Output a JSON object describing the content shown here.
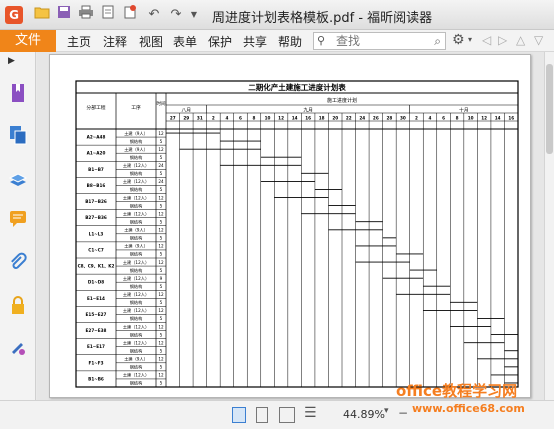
{
  "window": {
    "title": "周进度计划表格模板.pdf - 福昕阅读器",
    "logo_letter": "G"
  },
  "menu": {
    "file": "文件",
    "items": [
      "主页",
      "注释",
      "视图",
      "表单",
      "保护",
      "共享",
      "帮助"
    ]
  },
  "search": {
    "placeholder": "查找"
  },
  "document": {
    "title": "二期化产土建施工进度计划表",
    "header_group": "施工进度计划",
    "col_section": "分部工程",
    "col_process": "工序",
    "col_time": "时间",
    "months": [
      "八月",
      "九月",
      "十月"
    ],
    "days": [
      "27",
      "29",
      "31",
      "2",
      "4",
      "6",
      "8",
      "10",
      "12",
      "14",
      "16",
      "18",
      "20",
      "22",
      "24",
      "26",
      "28",
      "30",
      "2",
      "4",
      "6",
      "8",
      "10",
      "12",
      "14",
      "16"
    ],
    "sections": [
      "A2~A48",
      "A1~A20",
      "B1~B7",
      "B8~B16",
      "B17~B26",
      "B27~B36",
      "L1~L3",
      "C1~C7",
      "C8、C9、K1、K2",
      "D1~D8",
      "E1~E14",
      "E15~E27",
      "E27~E38",
      "E1~E17",
      "F1~F3",
      "B1~B6"
    ],
    "rows": [
      {
        "p": "土建（9人）",
        "t": "12"
      },
      {
        "p": "钢结构",
        "t": "5"
      },
      {
        "p": "土建（9人）",
        "t": "12"
      },
      {
        "p": "钢结构",
        "t": "5"
      },
      {
        "p": "土建（12人）",
        "t": "24"
      },
      {
        "p": "钢结构",
        "t": "5"
      },
      {
        "p": "土建（12人）",
        "t": "24"
      },
      {
        "p": "钢结构",
        "t": "5"
      },
      {
        "p": "土建（12人）",
        "t": "12"
      },
      {
        "p": "钢结构",
        "t": "5"
      },
      {
        "p": "土建（12人）",
        "t": "12"
      },
      {
        "p": "钢结构",
        "t": "5"
      },
      {
        "p": "土建（9人）",
        "t": "12"
      },
      {
        "p": "钢结构",
        "t": "5"
      },
      {
        "p": "土建（9人）",
        "t": "12"
      },
      {
        "p": "钢结构",
        "t": "5"
      },
      {
        "p": "土建（12人）",
        "t": "12"
      },
      {
        "p": "钢结构",
        "t": "5"
      },
      {
        "p": "土建（12人）",
        "t": "9"
      },
      {
        "p": "钢结构",
        "t": "5"
      },
      {
        "p": "土建（12人）",
        "t": "12"
      },
      {
        "p": "钢结构",
        "t": "5"
      },
      {
        "p": "土建（12人）",
        "t": "12"
      },
      {
        "p": "钢结构",
        "t": "5"
      },
      {
        "p": "土建（12人）",
        "t": "12"
      },
      {
        "p": "钢结构",
        "t": "5"
      },
      {
        "p": "土建（12人）",
        "t": "12"
      },
      {
        "p": "钢结构",
        "t": "5"
      },
      {
        "p": "土建（9人）",
        "t": "12"
      },
      {
        "p": "钢结构",
        "t": "5"
      },
      {
        "p": "土建（12人）",
        "t": "12"
      },
      {
        "p": "钢结构",
        "t": "5"
      }
    ]
  },
  "status": {
    "zoom": "44.89%"
  },
  "watermark": {
    "line1": "office教程学习网",
    "line2": "www.office68.com"
  }
}
